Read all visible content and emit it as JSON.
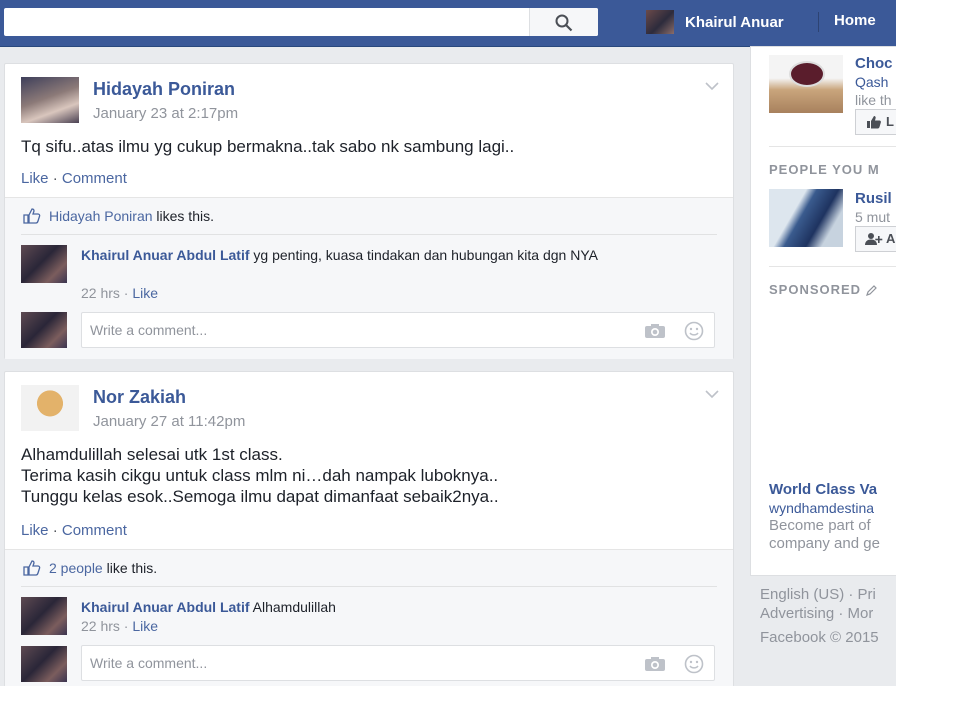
{
  "header": {
    "user_name": "Khairul Anuar",
    "home_label": "Home"
  },
  "posts": [
    {
      "author": "Hidayah Poniran",
      "date": "January 23 at 2:17pm",
      "text": [
        "Tq sifu..atas ilmu yg cukup bermakna..tak sabo nk sambung lagi.."
      ],
      "like_label": "Like",
      "comment_label": "Comment",
      "likes_who": "Hidayah Poniran",
      "likes_suffix": "likes this.",
      "comment": {
        "name": "Khairul Anuar Abdul Latif",
        "text": "yg penting, kuasa tindakan dan hubungan kita dgn NYA",
        "time": "22 hrs",
        "like_label": "Like"
      },
      "write_placeholder": "Write a comment..."
    },
    {
      "author": "Nor Zakiah",
      "date": "January 27 at 11:42pm",
      "text": [
        "Alhamdulillah selesai utk 1st class.",
        "Terima kasih cikgu untuk class mlm ni…dah nampak luboknya..",
        "Tunggu kelas esok..Semoga ilmu dapat dimanfaat sebaik2nya.."
      ],
      "like_label": "Like",
      "comment_label": "Comment",
      "likes_who": "2 people",
      "likes_suffix": "like this.",
      "comment": {
        "name": "Khairul Anuar Abdul Latif",
        "text": "Alhamdulillah",
        "time": "22 hrs",
        "like_label": "Like"
      },
      "write_placeholder": "Write a comment..."
    }
  ],
  "sidebar": {
    "page_suggestion": {
      "title": "Choc",
      "subtitle": "Qash",
      "meta": "like th",
      "button": "L"
    },
    "people_heading": "PEOPLE YOU M",
    "person": {
      "name": "Rusil",
      "meta": "5 mut",
      "button": "A"
    },
    "sponsored_heading": "SPONSORED",
    "ad": {
      "title": "World Class Va",
      "domain": "wyndhamdestina",
      "line1": "Become part of",
      "line2": "company and ge"
    },
    "footer": {
      "line1": "English (US) · Pri",
      "line2": "Advertising · Mor",
      "line3": "Facebook © 2015"
    }
  },
  "colors": {
    "brand": "#3b5998",
    "link": "#4b67a1",
    "muted": "#90949c"
  }
}
